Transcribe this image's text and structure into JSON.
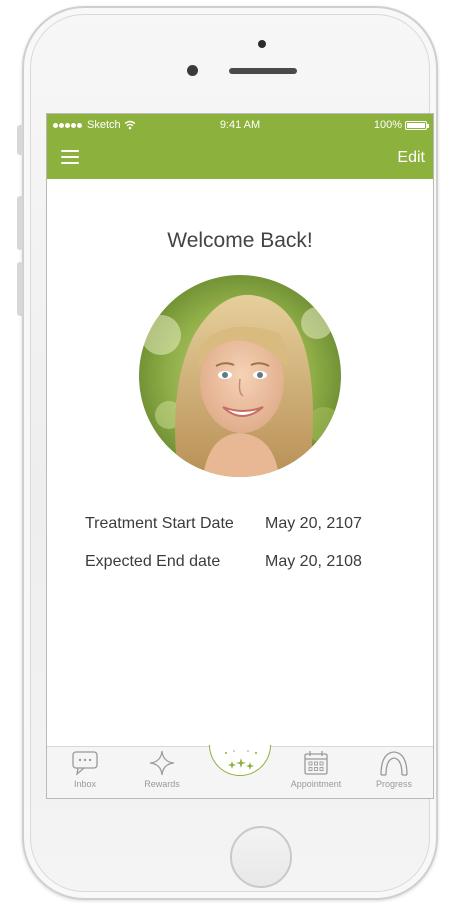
{
  "status_bar": {
    "carrier": "Sketch",
    "time": "9:41 AM",
    "battery": "100%"
  },
  "nav": {
    "menu_icon": "hamburger-menu-icon",
    "edit_label": "Edit"
  },
  "main": {
    "welcome": "Welcome Back!",
    "avatar_icon": "profile-photo",
    "details": [
      {
        "label": "Treatment Start Date",
        "value": "May 20, 2107"
      },
      {
        "label": "Expected End date",
        "value": "May 20, 2108"
      }
    ]
  },
  "tabbar": {
    "tabs": [
      {
        "label": "Inbox",
        "icon": "chat-bubble-icon"
      },
      {
        "label": "Rewards",
        "icon": "sparkle-star-icon"
      },
      {
        "label": "",
        "icon": "stars-home-icon"
      },
      {
        "label": "Appointment",
        "icon": "calendar-icon"
      },
      {
        "label": "Progress",
        "icon": "aligner-arch-icon"
      }
    ]
  },
  "colors": {
    "accent": "#8cb13c",
    "text": "#3c3c3c",
    "tab_label": "#9a9a9a"
  }
}
